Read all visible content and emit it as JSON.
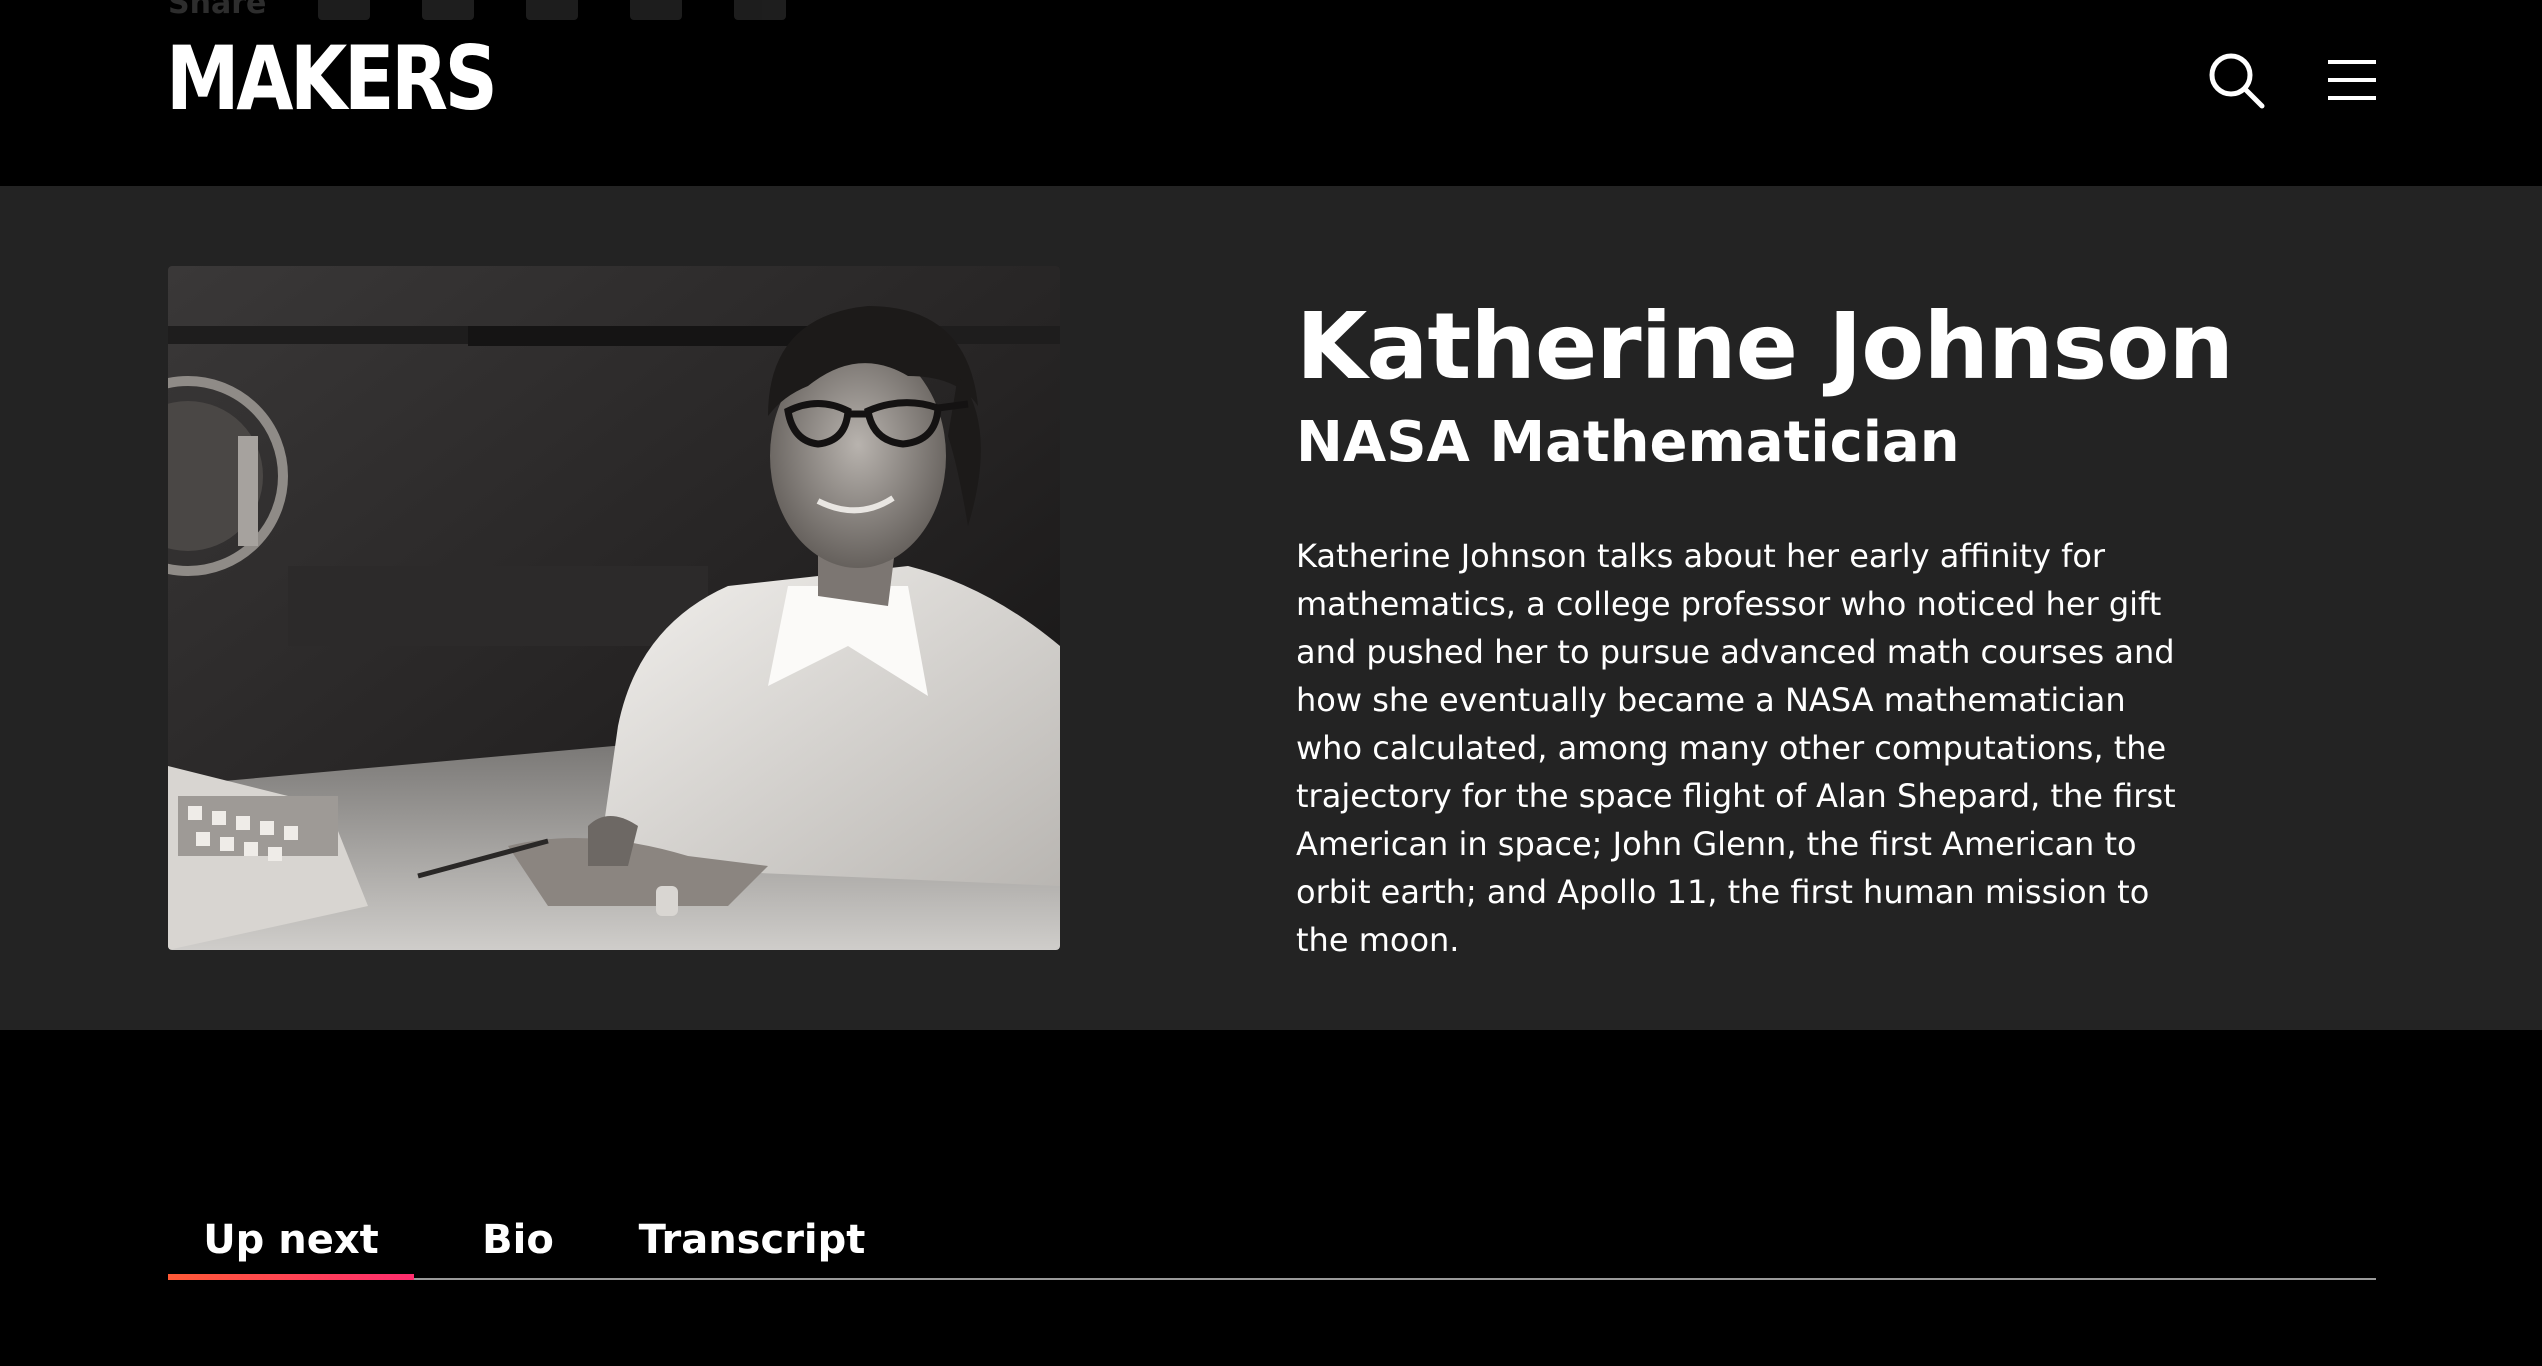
{
  "header": {
    "share_label": "Share",
    "logo_text": "MAKERS",
    "share_icons": [
      "facebook-icon",
      "twitter-icon",
      "linkedin-icon",
      "tumblr-icon",
      "email-icon"
    ],
    "search_icon": "search-icon",
    "menu_icon": "hamburger-menu-icon"
  },
  "hero": {
    "name": "Katherine Johnson",
    "role": "NASA Mathematician",
    "description": "Katherine Johnson talks about her early affinity for mathematics, a college professor who noticed her gift and pushed her to pursue advanced math courses and how she eventually became a NASA mathematician who calculated, among many other computations, the trajectory for the space flight of Alan Shepard, the first American in space; John Glenn, the first American to orbit earth; and Apollo 11, the first human mission to the moon.",
    "photo_alt": "Katherine Johnson"
  },
  "tabs": {
    "items": [
      {
        "label": "Up next",
        "active": true
      },
      {
        "label": "Bio",
        "active": false
      },
      {
        "label": "Transcript",
        "active": false
      }
    ]
  },
  "colors": {
    "background": "#000000",
    "hero_background": "#232323",
    "accent_gradient_start": "#ff5a36",
    "accent_gradient_end": "#ff2d6f",
    "text": "#ffffff"
  }
}
